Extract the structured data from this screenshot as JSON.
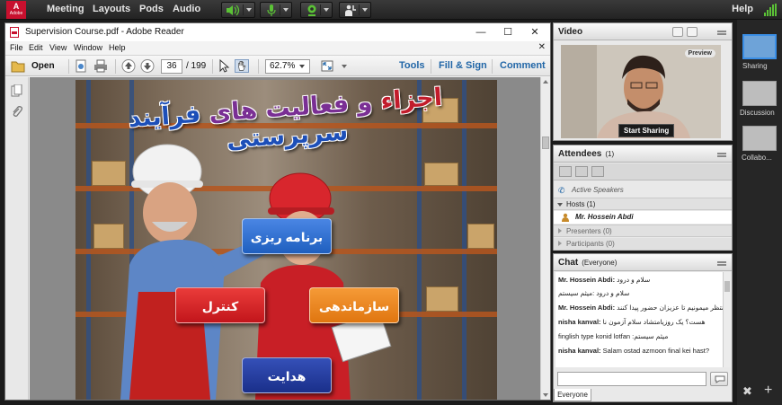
{
  "topbar": {
    "logo": "Adobe",
    "menu": [
      "Meeting",
      "Layouts",
      "Pods",
      "Audio"
    ],
    "help": "Help"
  },
  "pdf": {
    "title": "Supervision Course.pdf - Adobe Reader",
    "menu": [
      "File",
      "Edit",
      "View",
      "Window",
      "Help"
    ],
    "toolbar": {
      "open": "Open",
      "page_current": "36",
      "page_total": "/ 199",
      "zoom": "62.7%",
      "tools": "Tools",
      "fill_sign": "Fill & Sign",
      "comment": "Comment"
    },
    "slide": {
      "title_part1": "اجزاء",
      "title_part2": " و فعالیت های ",
      "title_part3": "فرآیند سرپرستی",
      "btn_planning": "برنامه ریزی",
      "btn_organizing": "سازماندهی",
      "btn_control": "کنترل",
      "btn_leading": "هدایت",
      "colors": {
        "blue": "#1f5fbf",
        "red": "#c2151b",
        "orange": "#e07610",
        "navy": "#1a2f8a"
      }
    }
  },
  "video": {
    "title": "Video",
    "preview": "Preview",
    "start_sharing": "Start Sharing"
  },
  "attendees": {
    "title": "Attendees",
    "count": "(1)",
    "active_speakers": "Active Speakers",
    "hosts": "Hosts (1)",
    "host_name": "Mr. Hossein Abdi",
    "presenters": "Presenters (0)",
    "participants": "Participants (0)"
  },
  "chat": {
    "title": "Chat",
    "scope": "(Everyone)",
    "messages": [
      {
        "name": "Mr. Hossein Abdi:",
        "text": "سلام و درود"
      },
      {
        "name": "",
        "text": "سلام و درود :میثم سیستم"
      },
      {
        "name": "Mr. Hossein Abdi:",
        "text": "منتظر میمونیم تا عزیزان حضور پیدا کنند"
      },
      {
        "name": "nisha kanval:",
        "text": "هست؟ یک روزیامتشاد سلام آزمون نا"
      },
      {
        "name": "",
        "text": "finglish type konid lotfan :میثم سیستم"
      },
      {
        "name": "nisha kanval:",
        "text": "Salam ostad azmoon final kei hast?"
      }
    ],
    "tab": "Everyone"
  },
  "layouts": {
    "items": [
      "Sharing",
      "Discussion",
      "Collabo..."
    ]
  }
}
